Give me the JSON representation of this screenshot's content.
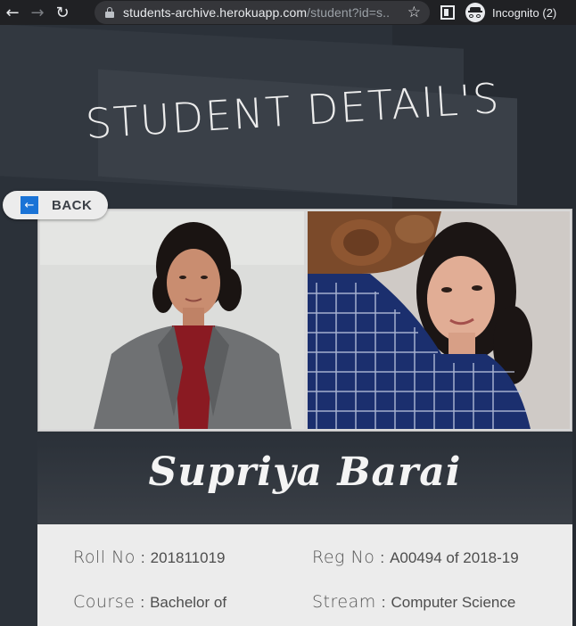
{
  "browser": {
    "url_host": "students-archive.herokuapp.com",
    "url_rest": "/student?id=s...",
    "incognito_label": "Incognito (2)"
  },
  "page": {
    "title": "STUDENT DETAIL'S",
    "back_label": "BACK",
    "student_name": "Supriya Barai",
    "details": {
      "roll_label": "Roll No",
      "roll_value": "201811019",
      "reg_label": "Reg No",
      "reg_value": "A00494 of 2018-19",
      "course_label": "Course",
      "course_value": "Bachelor of",
      "stream_label": "Stream",
      "stream_value": "Computer Science",
      "separator": ":"
    }
  },
  "icons": {
    "back": "arrow-left-icon",
    "forward": "arrow-right-icon",
    "reload": "reload-icon",
    "lock": "lock-icon",
    "star": "star-icon",
    "tab": "tab-search-icon",
    "incognito": "incognito-icon"
  },
  "colors": {
    "page_bg": "#2b3139",
    "back_icon": "#1a73d6",
    "panel": "#ececec"
  }
}
